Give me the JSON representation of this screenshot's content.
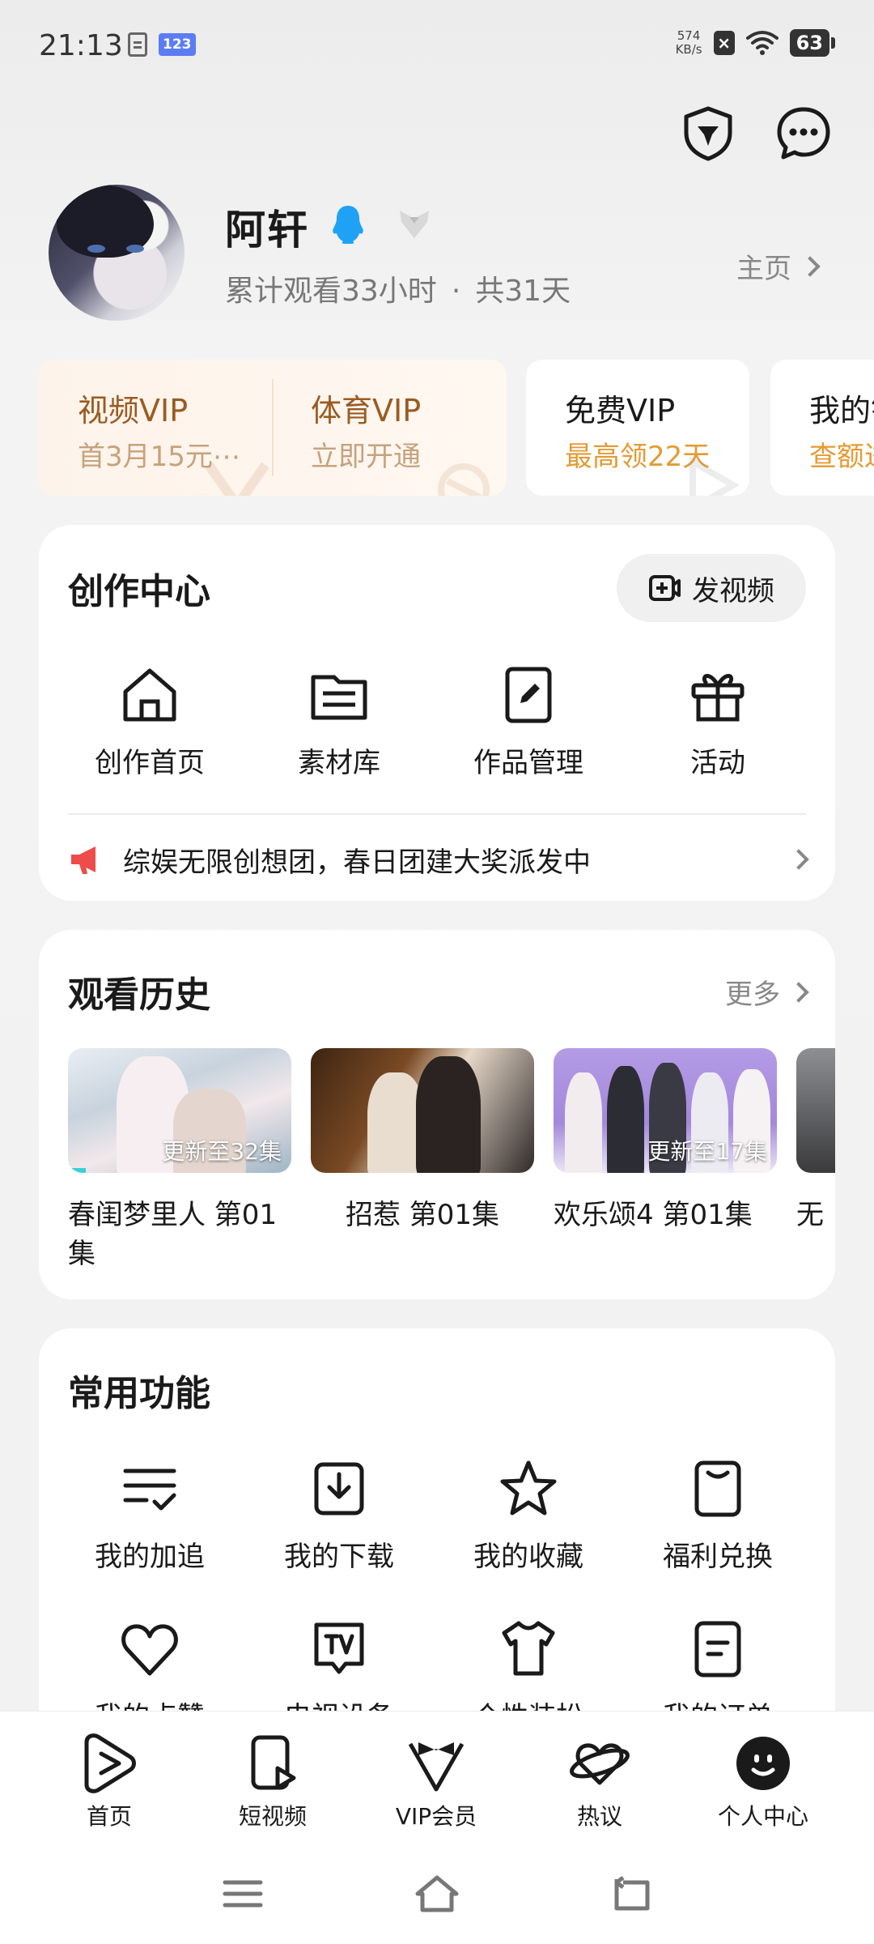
{
  "status_bar": {
    "time": "21:13",
    "badge": "123",
    "net_speed_value": "574",
    "net_speed_unit": "KB/s",
    "battery": "63"
  },
  "profile": {
    "username": "阿轩",
    "watch_time": "累计观看33小时",
    "separator": "·",
    "days": "共31天",
    "homepage_label": "主页"
  },
  "vip": [
    {
      "title": "视频VIP",
      "subtitle": "首3月15元⋯"
    },
    {
      "title": "体育VIP",
      "subtitle": "立即开通"
    },
    {
      "title": "免费VIP",
      "subtitle": "最高领22天"
    },
    {
      "title": "我的钱",
      "subtitle": "查额进"
    }
  ],
  "creation_center": {
    "title": "创作中心",
    "post_button": "发视频",
    "items": [
      {
        "label": "创作首页",
        "icon": "house-icon"
      },
      {
        "label": "素材库",
        "icon": "library-icon"
      },
      {
        "label": "作品管理",
        "icon": "edit-icon"
      },
      {
        "label": "活动",
        "icon": "gift-icon"
      }
    ],
    "notice": "综娱无限创想团，春日团建大奖派发中"
  },
  "history": {
    "title": "观看历史",
    "more_label": "更多",
    "items": [
      {
        "title": "春闺梦里人 第01集",
        "badge": "更新至32集",
        "progress": 0.08
      },
      {
        "title": "招惹 第01集",
        "badge": "",
        "progress": 0
      },
      {
        "title": "欢乐颂4 第01集",
        "badge": "更新至17集",
        "progress": 0
      },
      {
        "title": "无",
        "badge": "",
        "progress": 0
      }
    ]
  },
  "common_functions": {
    "title": "常用功能",
    "row1": [
      {
        "label": "我的加追",
        "icon": "list-check-icon"
      },
      {
        "label": "我的下载",
        "icon": "download-icon"
      },
      {
        "label": "我的收藏",
        "icon": "star-icon"
      },
      {
        "label": "福利兑换",
        "icon": "bag-icon"
      }
    ],
    "row2": [
      {
        "label": "我的点赞",
        "icon": "heart-icon"
      },
      {
        "label": "电视设备",
        "icon": "tv-icon"
      },
      {
        "label": "个性装扮",
        "icon": "shirt-icon"
      },
      {
        "label": "我的订单",
        "icon": "order-icon"
      }
    ]
  },
  "bottom_nav": [
    {
      "label": "首页",
      "icon": "play-logo-icon"
    },
    {
      "label": "短视频",
      "icon": "short-video-icon"
    },
    {
      "label": "VIP会员",
      "icon": "vip-bowtie-icon"
    },
    {
      "label": "热议",
      "icon": "planet-heart-icon"
    },
    {
      "label": "个人中心",
      "icon": "profile-face-icon",
      "active": true
    }
  ],
  "colors": {
    "vip_gold_text": "#9a5b22",
    "vip_gold_sub": "#c6a27c",
    "orange_accent": "#e49b33",
    "qq_blue": "#1fa2f5",
    "progress_teal": "#3ad0d9",
    "notice_red": "#ee4b4b"
  }
}
